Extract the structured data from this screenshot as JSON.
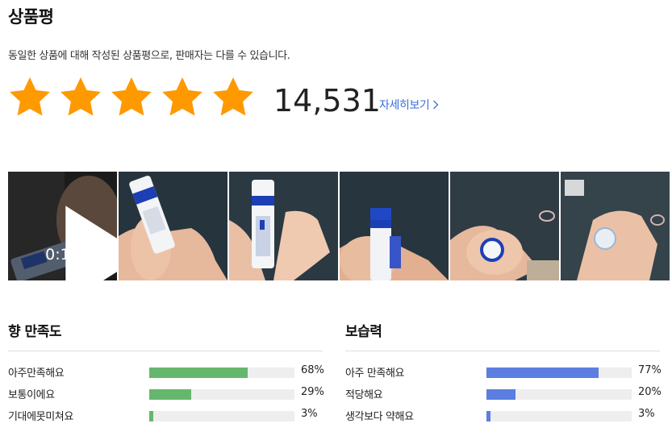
{
  "header": {
    "title": "상품평",
    "notice": "동일한 상품에 대해 작성된 상품평으로, 판매자는 다를 수 있습니다."
  },
  "rating": {
    "stars_filled": 5,
    "stars_total": 5,
    "review_count": "14,531",
    "more_link": "자세히보기"
  },
  "gallery": {
    "video_duration": "0:10",
    "thumbnails": [
      {
        "kind": "video"
      },
      {
        "kind": "photo"
      },
      {
        "kind": "photo"
      },
      {
        "kind": "photo"
      },
      {
        "kind": "photo"
      },
      {
        "kind": "photo"
      }
    ]
  },
  "surveys": [
    {
      "title": "향 만족도",
      "color": "#65b76d",
      "rows": [
        {
          "label": "아주만족해요",
          "percent": 68,
          "percent_text": "68%"
        },
        {
          "label": "보통이에요",
          "percent": 29,
          "percent_text": "29%"
        },
        {
          "label": "기대에못미쳐요",
          "percent": 3,
          "percent_text": "3%"
        }
      ]
    },
    {
      "title": "보습력",
      "color": "#5b7ee0",
      "rows": [
        {
          "label": "아주 만족해요",
          "percent": 77,
          "percent_text": "77%"
        },
        {
          "label": "적당해요",
          "percent": 20,
          "percent_text": "20%"
        },
        {
          "label": "생각보다 약해요",
          "percent": 3,
          "percent_text": "3%"
        }
      ]
    }
  ],
  "colors": {
    "star": "#ff9900",
    "link": "#3a6fd8"
  }
}
